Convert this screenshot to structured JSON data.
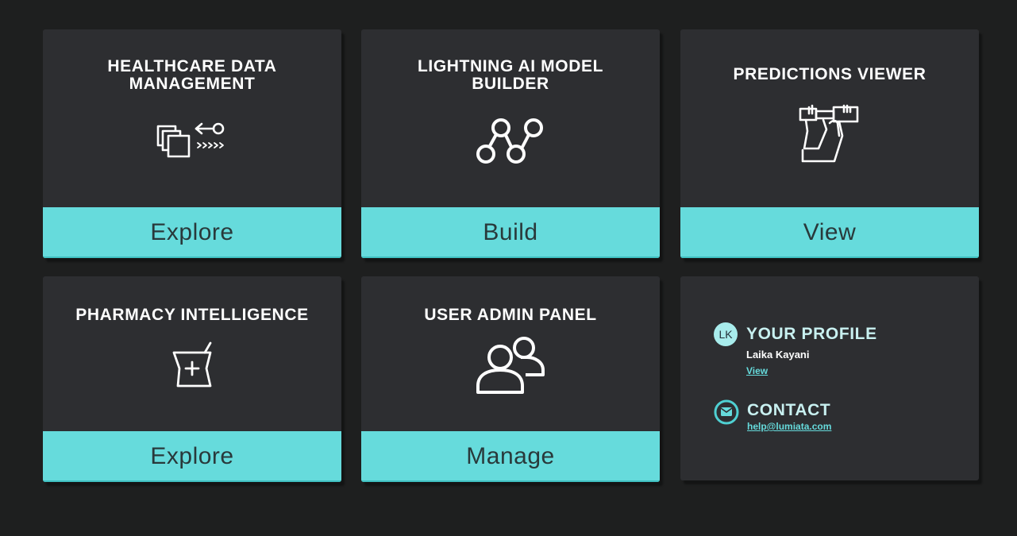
{
  "cards": [
    {
      "title": "HEALTHCARE DATA MANAGEMENT",
      "action": "Explore",
      "icon": "data-transfer-icon"
    },
    {
      "title": "LIGHTNING AI MODEL BUILDER",
      "action": "Build",
      "icon": "model-graph-icon"
    },
    {
      "title": "PREDICTIONS VIEWER",
      "action": "View",
      "icon": "binoculars-icon"
    },
    {
      "title": "PHARMACY INTELLIGENCE",
      "action": "Explore",
      "icon": "mortar-pestle-icon"
    },
    {
      "title": "USER ADMIN PANEL",
      "action": "Manage",
      "icon": "users-icon"
    }
  ],
  "profile": {
    "initials": "LK",
    "heading": "YOUR PROFILE",
    "name": "Laika Kayani",
    "link": "View"
  },
  "contact": {
    "heading": "CONTACT",
    "email": "help@lumiata.com",
    "icon": "mail-icon"
  },
  "colors": {
    "background": "#1e1f1f",
    "card": "#2d2e31",
    "accent": "#66dbdc",
    "button_text": "#29393b"
  }
}
